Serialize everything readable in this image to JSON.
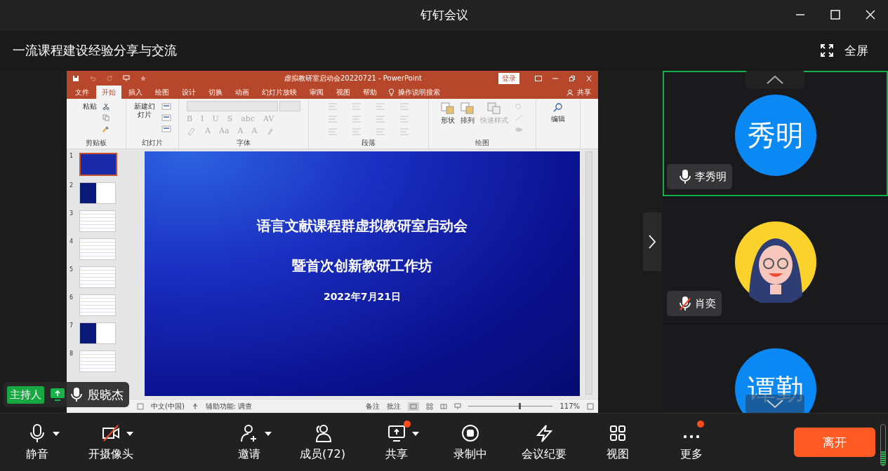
{
  "window": {
    "title": "钉钉会议"
  },
  "meeting": {
    "topic": "一流课程建设经验分享与交流",
    "fullscreen_label": "全屏"
  },
  "shared_screen": {
    "ppt": {
      "title": "虚拟教研室启动会20220721 - PowerPoint",
      "sign_in": "登录",
      "tabs": [
        {
          "label": "文件",
          "selected": false
        },
        {
          "label": "开始",
          "selected": true
        },
        {
          "label": "插入",
          "selected": false
        },
        {
          "label": "绘图",
          "selected": false
        },
        {
          "label": "设计",
          "selected": false
        },
        {
          "label": "切换",
          "selected": false
        },
        {
          "label": "动画",
          "selected": false
        },
        {
          "label": "幻灯片放映",
          "selected": false
        },
        {
          "label": "审阅",
          "selected": false
        },
        {
          "label": "视图",
          "selected": false
        },
        {
          "label": "帮助",
          "selected": false
        }
      ],
      "search": "操作说明搜索",
      "share": "共享",
      "ribbon": [
        {
          "kind": "clipboard",
          "label": "剪贴板",
          "buttons": [
            {
              "label": "粘贴",
              "disabled": false
            }
          ]
        },
        {
          "kind": "slides",
          "label": "幻灯片",
          "buttons": [
            {
              "label": "新建幻灯片",
              "disabled": false
            }
          ]
        },
        {
          "kind": "font",
          "label": "字体",
          "glyphs": [
            "B",
            "I",
            "U",
            "S",
            "abc",
            "AV"
          ],
          "glyphs_2": [
            "A",
            "Aa",
            "A",
            "A"
          ]
        },
        {
          "kind": "paragraph",
          "label": "段落"
        },
        {
          "kind": "drawing",
          "label": "绘图",
          "buttons": [
            {
              "label": "形状",
              "disabled": false
            },
            {
              "label": "排列",
              "disabled": false
            },
            {
              "label": "快速样式",
              "disabled": true
            }
          ]
        },
        {
          "kind": "editing",
          "buttons": [
            {
              "label": "编辑",
              "disabled": false
            }
          ]
        }
      ],
      "thumbnails": [
        {
          "number": "1",
          "selected": true,
          "kind": "title"
        },
        {
          "number": "2",
          "selected": false,
          "kind": "dark"
        },
        {
          "number": "3",
          "selected": false,
          "kind": "light"
        },
        {
          "number": "4",
          "selected": false,
          "kind": "light"
        },
        {
          "number": "5",
          "selected": false,
          "kind": "light"
        },
        {
          "number": "6",
          "selected": false,
          "kind": "light"
        },
        {
          "number": "7",
          "selected": false,
          "kind": "dark"
        },
        {
          "number": "8",
          "selected": false,
          "kind": "light"
        }
      ],
      "slide": {
        "title": "语言文献课程群虚拟教研室启动会",
        "subtitle": "暨首次创新教研工作坊",
        "date": "2022年7月21日"
      },
      "status_bar": {
        "language": "中文(中国)",
        "accessibility": "辅助功能: 调查",
        "notes": "备注",
        "comments": "批注",
        "zoom": {
          "level": 0.6
        },
        "zoom_reading": "117%"
      }
    },
    "presenter": {
      "role": "主持人",
      "name": "殷晓杰"
    }
  },
  "participants": [
    {
      "kind": "initials",
      "avatar_text": "秀明",
      "name": "李秀明",
      "muted": false,
      "speaking": true
    },
    {
      "kind": "illustration",
      "name": "肖奕",
      "muted": true,
      "speaking": false
    },
    {
      "kind": "initials",
      "avatar_text": "谭勤",
      "speaking": false
    }
  ],
  "toolbar": {
    "left": [
      {
        "kind": "mic",
        "label": "静音",
        "dropdown": true,
        "badge": false,
        "off": false
      },
      {
        "kind": "camera",
        "label": "开摄像头",
        "dropdown": true,
        "badge": false,
        "off": true
      }
    ],
    "center": [
      {
        "kind": "invite",
        "label": "邀请",
        "dropdown": true,
        "badge": false,
        "off": false
      },
      {
        "kind": "members",
        "label": "成员(72)",
        "dropdown": false,
        "badge": false,
        "off": false
      },
      {
        "kind": "share",
        "label": "共享",
        "dropdown": true,
        "badge": true,
        "off": false
      },
      {
        "kind": "record",
        "label": "录制中",
        "dropdown": false,
        "badge": false,
        "off": false
      },
      {
        "kind": "minutes",
        "label": "会议纪要",
        "dropdown": false,
        "badge": false,
        "off": false
      },
      {
        "kind": "view",
        "label": "视图",
        "dropdown": false,
        "badge": false,
        "off": false
      },
      {
        "kind": "more",
        "label": "更多",
        "dropdown": false,
        "badge": true,
        "off": false
      }
    ]
  },
  "leave_button": "离开"
}
